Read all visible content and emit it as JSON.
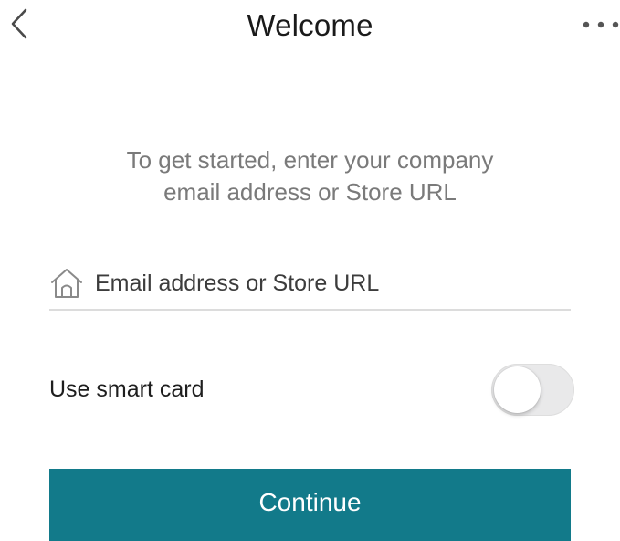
{
  "header": {
    "title": "Welcome",
    "back_icon": "chevron-left-icon",
    "more_icon": "more-horizontal-icon"
  },
  "intro": {
    "line1": "To get started, enter your company",
    "line2": "email address or Store URL"
  },
  "store_input": {
    "icon": "house-icon",
    "value": "",
    "placeholder": "Email address or Store URL"
  },
  "smart_card": {
    "label": "Use smart card",
    "enabled": false
  },
  "continue_button": {
    "label": "Continue"
  },
  "colors": {
    "accent": "#127a8a",
    "intro_text": "#7a7a7a",
    "toggle_off": "#e9e9ea",
    "divider": "#dcdcdc"
  }
}
